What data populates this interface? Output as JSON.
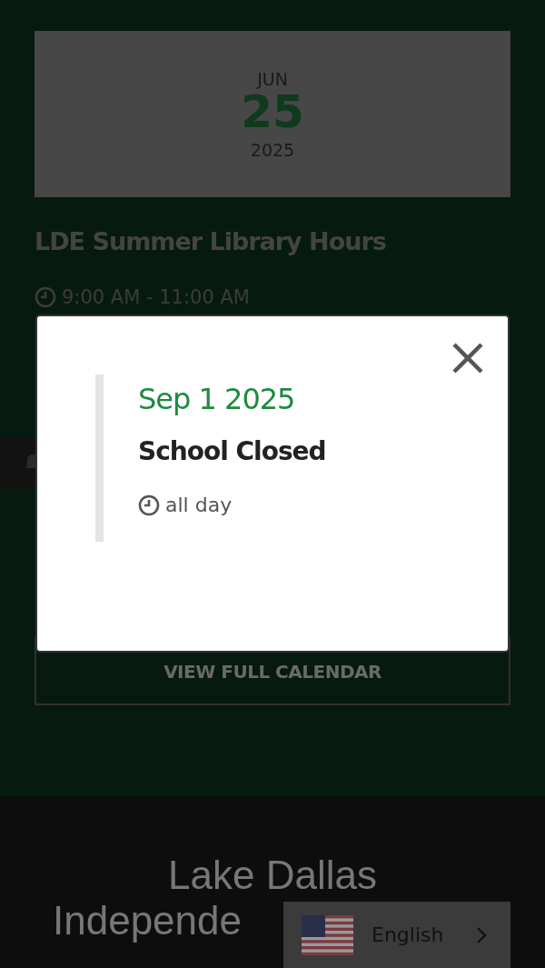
{
  "event_card": {
    "month": "JUN",
    "day": "25",
    "year": "2025",
    "title": "LDE Summer Library Hours",
    "time": "9:00 AM - 11:00 AM"
  },
  "calendar_button": "VIEW FULL CALENDAR",
  "footer": {
    "lines": [
      "Lake  Dallas",
      "Independe"
    ]
  },
  "modal": {
    "date": "Sep 1 2025",
    "title": "School Closed",
    "time": "all day"
  },
  "language": {
    "label": "English"
  }
}
